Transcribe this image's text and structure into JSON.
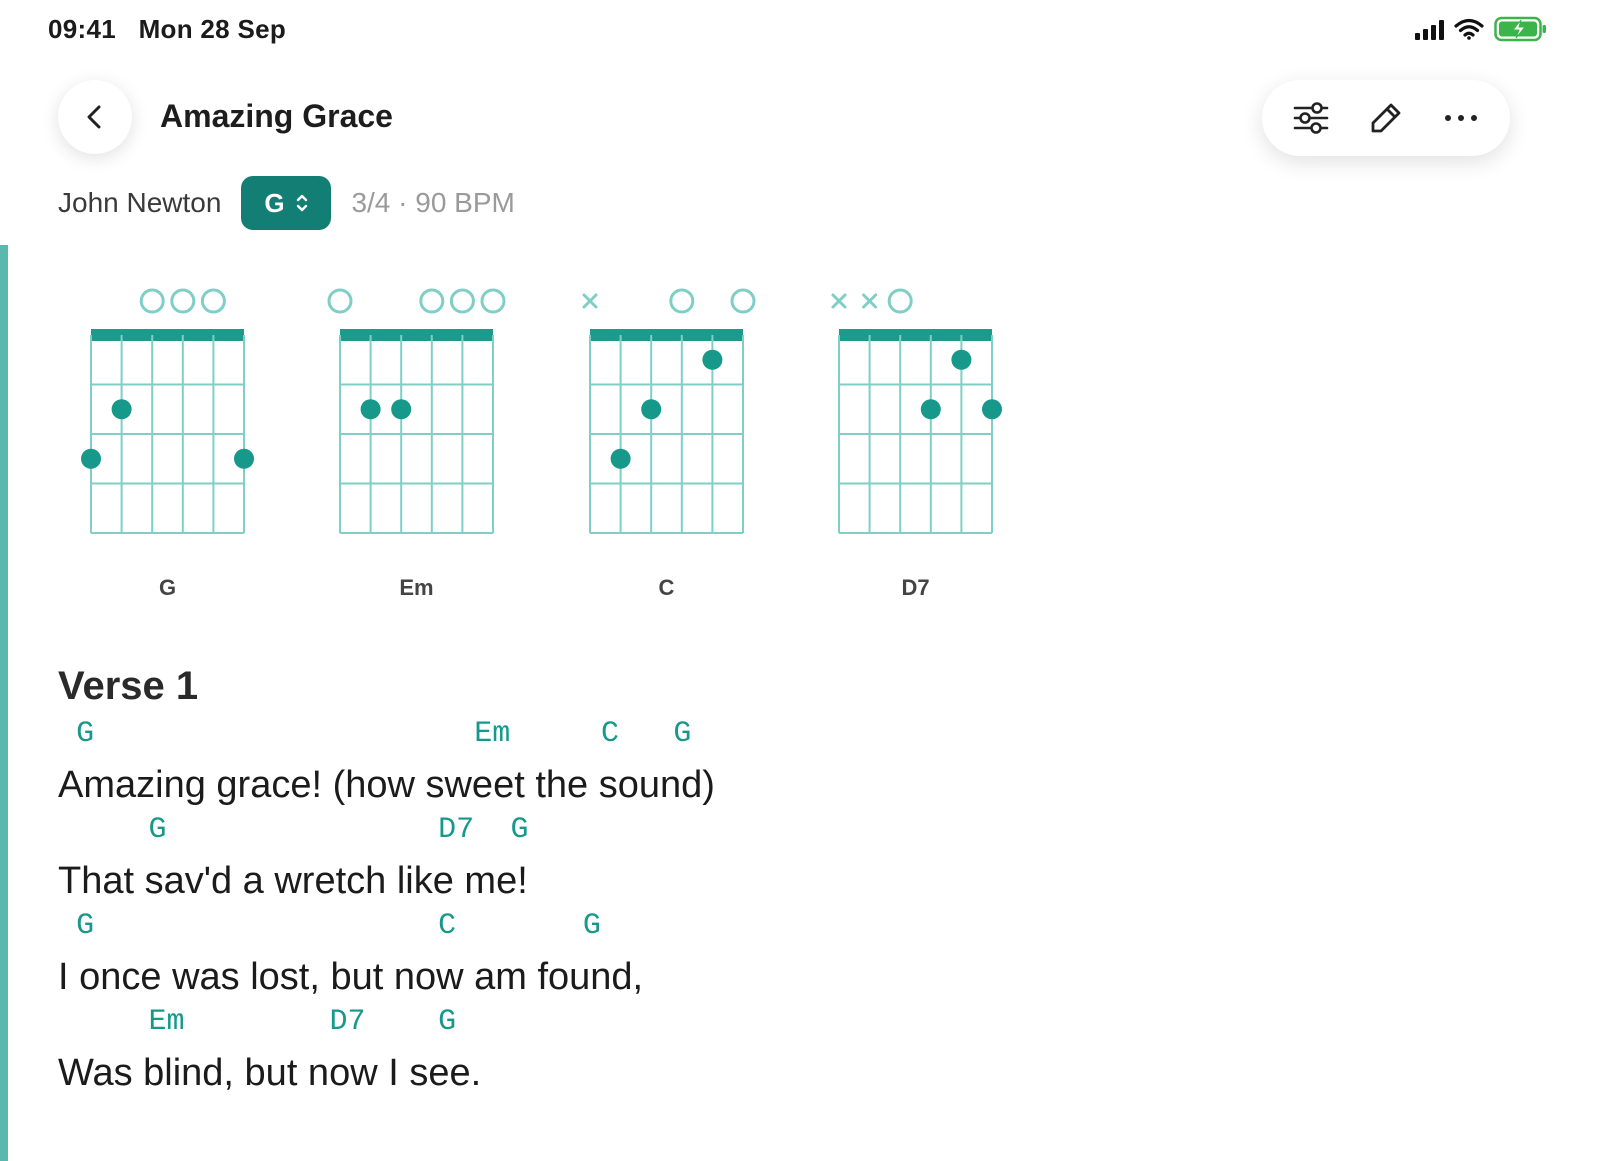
{
  "status": {
    "time": "09:41",
    "date": "Mon 28 Sep"
  },
  "header": {
    "title": "Amazing Grace"
  },
  "toolbar": {
    "icons": [
      "sliders-icon",
      "pencil-icon",
      "more-icon"
    ]
  },
  "meta": {
    "author": "John Newton",
    "key": "G",
    "tempo": "3/4 · 90 BPM"
  },
  "colors": {
    "accent": "#137f74",
    "chord_text": "#16998b",
    "accent_bar": "#5ab9ae"
  },
  "chord_diagrams": [
    {
      "name": "G",
      "strings": [
        "",
        "",
        "o",
        "o",
        "o",
        ""
      ],
      "dots": [
        [
          1,
          2
        ],
        [
          0,
          3
        ],
        [
          5,
          3
        ]
      ]
    },
    {
      "name": "Em",
      "strings": [
        "o",
        "",
        "",
        "o",
        "o",
        "o"
      ],
      "dots": [
        [
          1,
          2
        ],
        [
          2,
          2
        ]
      ]
    },
    {
      "name": "C",
      "strings": [
        "x",
        "",
        "",
        "o",
        "",
        "o"
      ],
      "dots": [
        [
          4,
          1
        ],
        [
          2,
          2
        ],
        [
          1,
          3
        ]
      ]
    },
    {
      "name": "D7",
      "strings": [
        "x",
        "x",
        "o",
        "",
        "",
        ""
      ],
      "dots": [
        [
          4,
          1
        ],
        [
          3,
          2
        ],
        [
          5,
          2
        ]
      ]
    }
  ],
  "verse": {
    "title": "Verse 1",
    "lines": [
      {
        "text": "Amazing grace! (how sweet the sound)",
        "chords": [
          {
            "c": "G",
            "pos": 1
          },
          {
            "c": "Em",
            "pos": 23
          },
          {
            "c": "C",
            "pos": 30
          },
          {
            "c": "G",
            "pos": 34
          }
        ]
      },
      {
        "text": "That sav'd a wretch like me!",
        "chords": [
          {
            "c": "G",
            "pos": 5
          },
          {
            "c": "D7",
            "pos": 21
          },
          {
            "c": "G",
            "pos": 25
          }
        ]
      },
      {
        "text": "I once was lost, but now am found,",
        "chords": [
          {
            "c": "G",
            "pos": 1
          },
          {
            "c": "C",
            "pos": 21
          },
          {
            "c": "G",
            "pos": 29
          }
        ]
      },
      {
        "text": "Was blind, but now I see.",
        "chords": [
          {
            "c": "Em",
            "pos": 5
          },
          {
            "c": "D7",
            "pos": 15
          },
          {
            "c": "G",
            "pos": 21
          }
        ]
      }
    ]
  }
}
